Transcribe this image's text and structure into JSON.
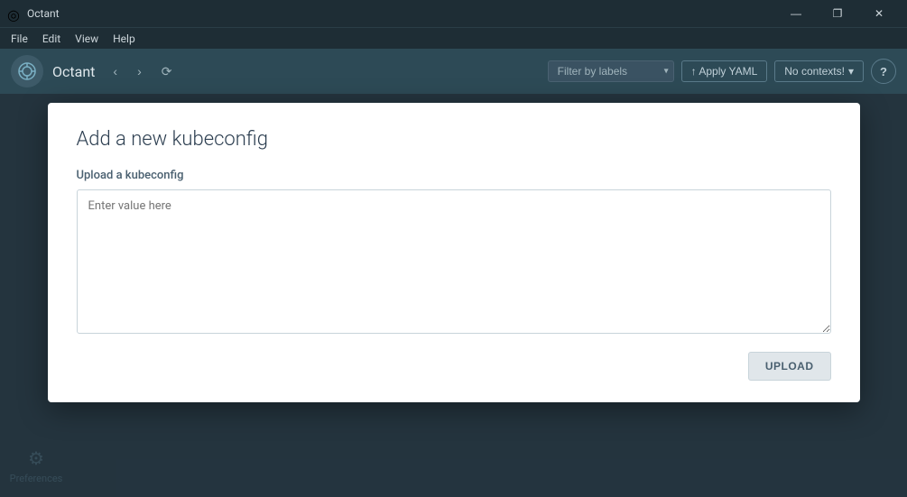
{
  "titleBar": {
    "appIcon": "◎",
    "title": "Octant",
    "controls": {
      "minimize": "—",
      "maximize": "❐",
      "close": "✕"
    }
  },
  "menuBar": {
    "items": [
      "File",
      "Edit",
      "View",
      "Help"
    ]
  },
  "navBar": {
    "appName": "Octant",
    "backButton": "‹",
    "forwardButton": "›",
    "historyButton": "⟳",
    "filterPlaceholder": "Filter by labels",
    "applyYaml": "↑  Apply YAML",
    "contexts": "No contexts!",
    "helpButton": "?"
  },
  "modal": {
    "title": "Add a new kubeconfig",
    "fieldLabel": "Upload a kubeconfig",
    "textareaPlaceholder": "Enter value here",
    "uploadButton": "UPLOAD"
  },
  "sidebar": {
    "preferences": {
      "icon": "⚙",
      "label": "Preferences"
    }
  }
}
